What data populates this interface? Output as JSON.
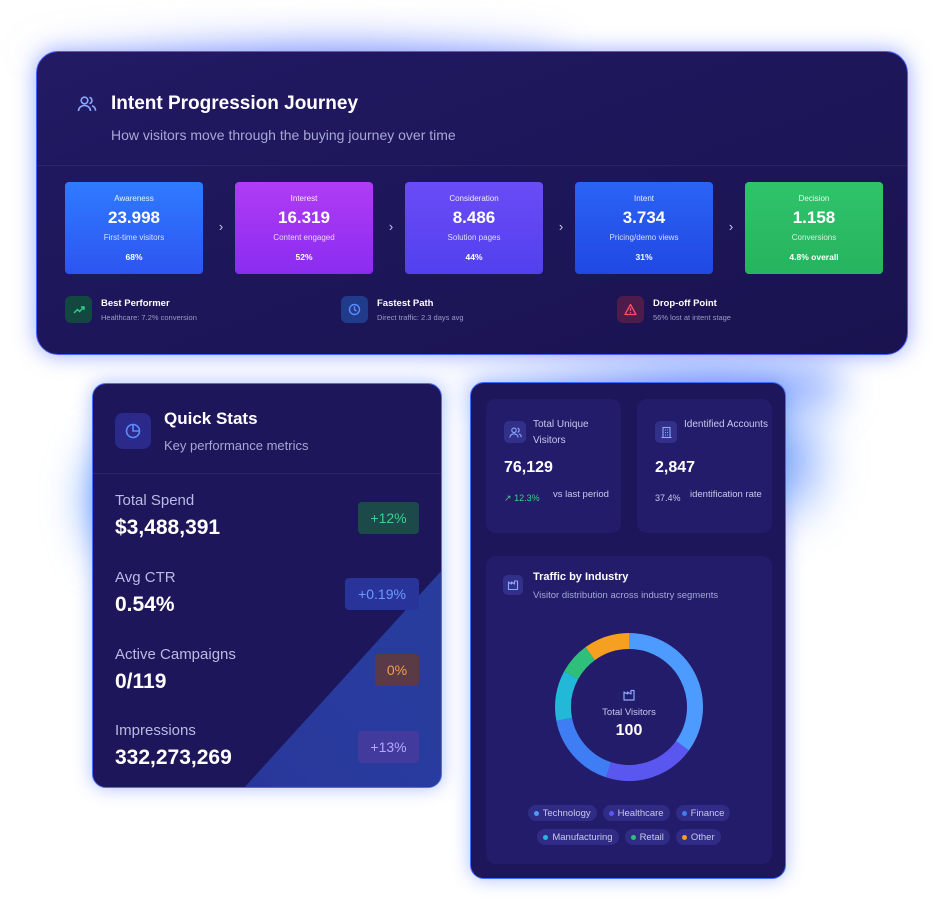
{
  "journey": {
    "title": "Intent Progression Journey",
    "subtitle": "How visitors move through the buying journey over time",
    "stages": [
      {
        "name": "Awareness",
        "value": "23.998",
        "desc": "First-time visitors",
        "pct": "68%",
        "color_from": "#2f7bff",
        "color_to": "#2d55f0"
      },
      {
        "name": "Interest",
        "value": "16.319",
        "desc": "Content engaged",
        "pct": "52%",
        "color_from": "#b03cf5",
        "color_to": "#8a2cf0"
      },
      {
        "name": "Consideration",
        "value": "8.486",
        "desc": "Solution pages",
        "pct": "44%",
        "color_from": "#6a4cf6",
        "color_to": "#5240ee"
      },
      {
        "name": "Intent",
        "value": "3.734",
        "desc": "Pricing/demo views",
        "pct": "31%",
        "color_from": "#2b63f5",
        "color_to": "#2148e3"
      },
      {
        "name": "Decision",
        "value": "1.158",
        "desc": "Conversions",
        "pct": "4.8% overall",
        "color_from": "#2fc46a",
        "color_to": "#27b35f"
      }
    ],
    "chevron": "›",
    "insights": [
      {
        "title": "Best Performer",
        "sub": "Healthcare: 7.2% conversion",
        "icon": "trending-up-icon",
        "bg": "#12483f",
        "color": "#2fd08a"
      },
      {
        "title": "Fastest Path",
        "sub": "Direct traffic: 2.3 days avg",
        "icon": "clock-icon",
        "bg": "#203b8a",
        "color": "#5b8cff"
      },
      {
        "title": "Drop-off Point",
        "sub": "56% lost at intent stage",
        "icon": "warning-icon",
        "bg": "#4d1c4a",
        "color": "#ff4d6a"
      }
    ]
  },
  "quick_stats": {
    "title": "Quick Stats",
    "subtitle": "Key performance metrics",
    "icon": "pie-chart-icon",
    "rows": [
      {
        "label": "Total Spend",
        "value": "$3,488,391",
        "badge": "+12%",
        "badge_bg": "#1c4a4a",
        "badge_color": "#3ad08c"
      },
      {
        "label": "Avg CTR",
        "value": "0.54%",
        "badge": "+0.19%",
        "badge_bg": "#28349a",
        "badge_color": "#6d9bff"
      },
      {
        "label": "Active Campaigns",
        "value": "0/119",
        "badge": "0%",
        "badge_bg": "#5a3a46",
        "badge_color": "#f0a040"
      },
      {
        "label": "Impressions",
        "value": "332,273,269",
        "badge": "+13%",
        "badge_bg": "#433a9e",
        "badge_color": "#b6a8ff"
      }
    ]
  },
  "visitors": {
    "title": "Total Unique Visitors",
    "value": "76,129",
    "change": "12.3%",
    "change_note": "vs last period",
    "icon": "users-icon"
  },
  "accounts": {
    "title": "Identified Accounts",
    "value": "2,847",
    "rate": "37.4%",
    "rate_note": "identification rate",
    "icon": "building-icon"
  },
  "traffic": {
    "title": "Traffic by Industry",
    "subtitle": "Visitor distribution across industry segments",
    "icon": "factory-icon",
    "center_label": "Total Visitors",
    "center_value": "100",
    "segments": [
      {
        "name": "Technology",
        "value": 35,
        "color": "#4d9bff"
      },
      {
        "name": "Healthcare",
        "value": 20,
        "color": "#5a57f0"
      },
      {
        "name": "Finance",
        "value": 17,
        "color": "#3f7df5"
      },
      {
        "name": "Manufacturing",
        "value": 11,
        "color": "#22b8d8"
      },
      {
        "name": "Retail",
        "value": 7,
        "color": "#2ec07a"
      },
      {
        "name": "Other",
        "value": 10,
        "color": "#f5a020"
      }
    ]
  }
}
